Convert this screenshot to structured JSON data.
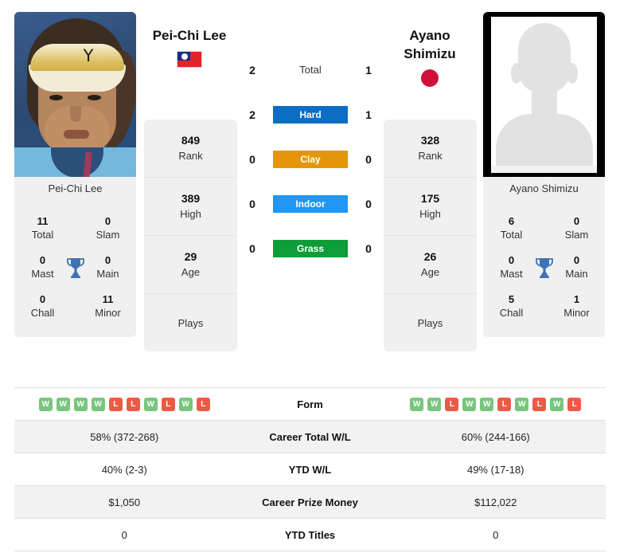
{
  "players": {
    "left": {
      "name": "Pei-Chi Lee",
      "photo_caption": "Pei-Chi Lee",
      "flag": "taiwan-flag",
      "titles": {
        "total_value": "11",
        "total_label": "Total",
        "slam_value": "0",
        "slam_label": "Slam",
        "mast_value": "0",
        "mast_label": "Mast",
        "main_value": "0",
        "main_label": "Main",
        "chall_value": "0",
        "chall_label": "Chall",
        "minor_value": "11",
        "minor_label": "Minor"
      },
      "meta": {
        "rank_value": "849",
        "rank_label": "Rank",
        "high_value": "389",
        "high_label": "High",
        "age_value": "29",
        "age_label": "Age",
        "plays_label": "Plays",
        "plays_value": ""
      },
      "form": [
        "W",
        "W",
        "W",
        "W",
        "L",
        "L",
        "W",
        "L",
        "W",
        "L"
      ],
      "career_total_wl": "58% (372-268)",
      "ytd_wl": "40% (2-3)",
      "career_prize_money": "$1,050",
      "ytd_titles": "0"
    },
    "right": {
      "name": "Ayano Shimizu",
      "name_line1": "Ayano",
      "name_line2": "Shimizu",
      "photo_caption": "Ayano Shimizu",
      "flag": "japan-flag",
      "titles": {
        "total_value": "6",
        "total_label": "Total",
        "slam_value": "0",
        "slam_label": "Slam",
        "mast_value": "0",
        "mast_label": "Mast",
        "main_value": "0",
        "main_label": "Main",
        "chall_value": "5",
        "chall_label": "Chall",
        "minor_value": "1",
        "minor_label": "Minor"
      },
      "meta": {
        "rank_value": "328",
        "rank_label": "Rank",
        "high_value": "175",
        "high_label": "High",
        "age_value": "26",
        "age_label": "Age",
        "plays_label": "Plays",
        "plays_value": ""
      },
      "form": [
        "W",
        "W",
        "L",
        "W",
        "W",
        "L",
        "W",
        "L",
        "W",
        "L"
      ],
      "career_total_wl": "60% (244-166)",
      "ytd_wl": "49% (17-18)",
      "career_prize_money": "$112,022",
      "ytd_titles": "0"
    }
  },
  "head_to_head": {
    "surfaces": [
      {
        "label": "Total",
        "left": "2",
        "right": "1",
        "color": ""
      },
      {
        "label": "Hard",
        "left": "2",
        "right": "1",
        "color": "#0b6dc4"
      },
      {
        "label": "Clay",
        "left": "0",
        "right": "0",
        "color": "#e3960a"
      },
      {
        "label": "Indoor",
        "left": "0",
        "right": "0",
        "color": "#2196f3"
      },
      {
        "label": "Grass",
        "left": "0",
        "right": "0",
        "color": "#0f9d38"
      }
    ]
  },
  "stats_table": {
    "rows": [
      {
        "label": "Form"
      },
      {
        "label": "Career Total W/L"
      },
      {
        "label": "YTD W/L"
      },
      {
        "label": "Career Prize Money"
      },
      {
        "label": "YTD Titles"
      }
    ]
  },
  "colors": {
    "hard": "#0b6dc4",
    "clay": "#e3960a",
    "indoor": "#2196f3",
    "grass": "#0f9d38",
    "win_badge": "#78c57e",
    "loss_badge": "#ee5a48",
    "trophy": "#3f72b4",
    "panel_bg": "#f0f0f0",
    "row_shade": "#f2f2f2"
  }
}
